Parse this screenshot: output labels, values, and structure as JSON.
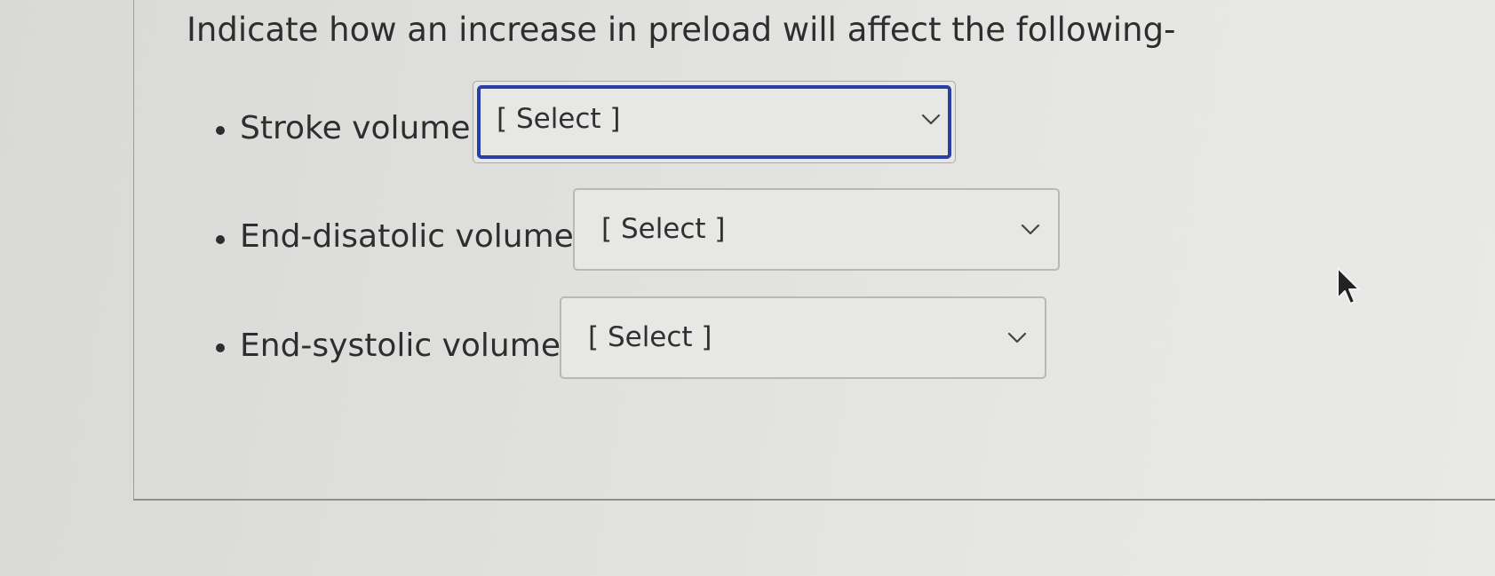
{
  "question": {
    "text": "Indicate how an increase in preload will affect the following-"
  },
  "items": [
    {
      "label": "Stroke volume",
      "select_value": "[ Select ]",
      "focused": true
    },
    {
      "label": "End-disatolic volume",
      "select_value": "[ Select ]",
      "focused": false
    },
    {
      "label": "End-systolic volume",
      "select_value": "[ Select ]",
      "focused": false
    }
  ],
  "colors": {
    "focus_ring": "#2a3ea8",
    "text": "#2e2e2e",
    "background": "#e3e3e1"
  },
  "icons": {
    "bullet": "bullet-icon",
    "dropdown": "chevron-down-icon",
    "pointer": "mouse-cursor-icon"
  }
}
